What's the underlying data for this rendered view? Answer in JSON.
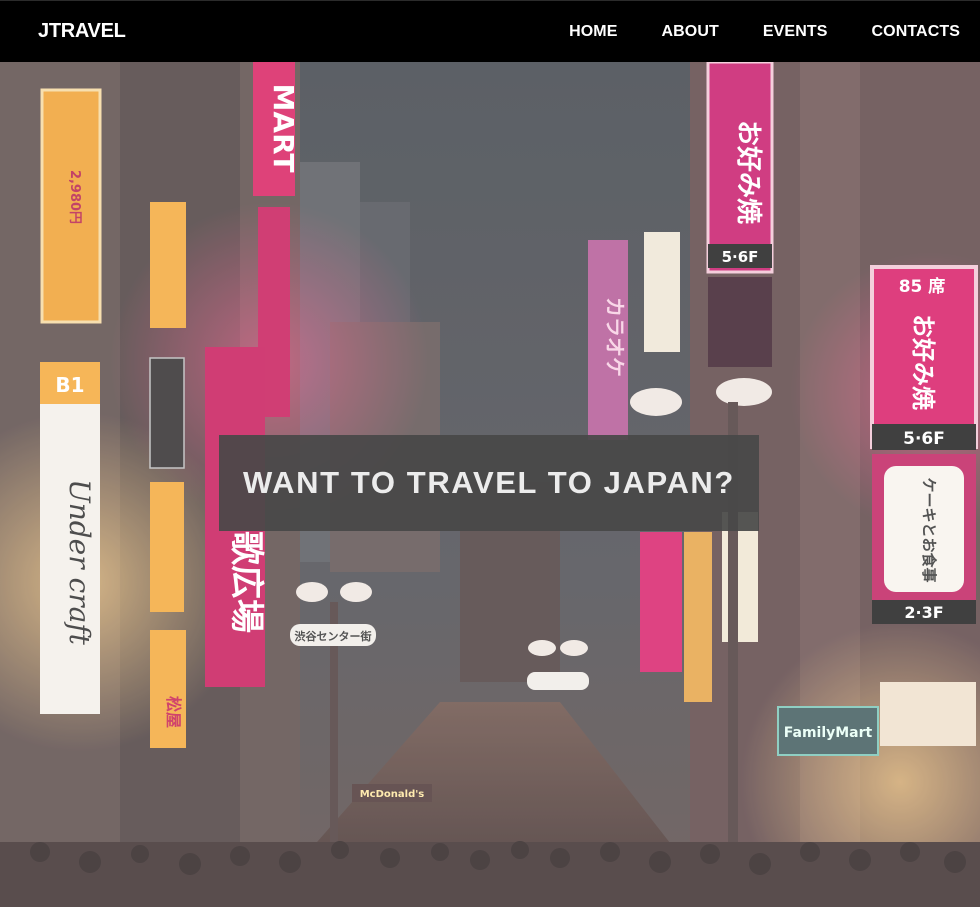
{
  "nav": {
    "brand": "JTRAVEL",
    "links": [
      {
        "label": "HOME"
      },
      {
        "label": "ABOUT"
      },
      {
        "label": "EVENTS"
      },
      {
        "label": "CONTACTS"
      }
    ]
  },
  "hero": {
    "title": "WANT TO TRAVEL TO JAPAN?",
    "image_signs": {
      "mart": "MART",
      "karaoke": "カラオケ",
      "okonomiyaki_top": "お好み焼",
      "okonomiyaki_right": "お好み焼",
      "floor_56f": "5·6F",
      "floor_85": "85 席",
      "floor_56f_right": "5·6F",
      "floor_23f": "2·3F",
      "under_craft": "Under craft",
      "b1": "B1",
      "price": "2,980円",
      "karaoke_hiroba": "歌広場",
      "cake": "ケーキとお食事",
      "familymart": "FamilyMart",
      "center_gai": "渋谷センター街",
      "mcdonalds": "McDonald's",
      "matsuya": "松屋"
    }
  },
  "colors": {
    "navbar_bg": "#000000",
    "nav_text": "#ffffff",
    "hero_box_bg": "#484848",
    "hero_text": "#ececec",
    "sign_pink": "#c8185a",
    "sign_orange": "#f0a030",
    "sign_white": "#f4f0ea"
  }
}
